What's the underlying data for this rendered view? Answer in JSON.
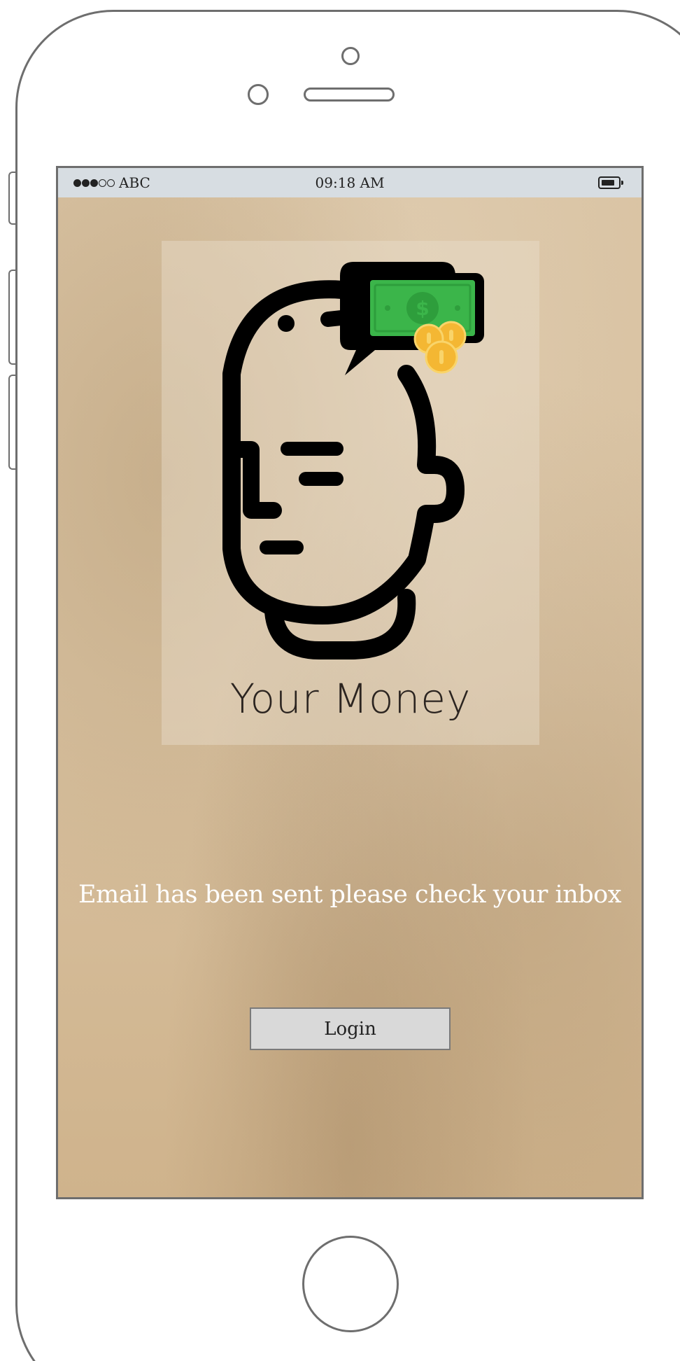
{
  "status_bar": {
    "carrier": "ABC",
    "time": "09:18 AM"
  },
  "app": {
    "name": "Your Money"
  },
  "main": {
    "message": "Email has been sent please check your inbox",
    "login_label": "Login"
  },
  "icons": {
    "logo": "head-with-money-thought-icon",
    "signal": "signal-strength-icon",
    "battery": "battery-icon"
  },
  "colors": {
    "background": "#d8c1a0",
    "message_text": "#ffffff",
    "button_fill": "#d9d9d9",
    "money_green": "#3bb54a",
    "coin_gold": "#f4b733"
  }
}
